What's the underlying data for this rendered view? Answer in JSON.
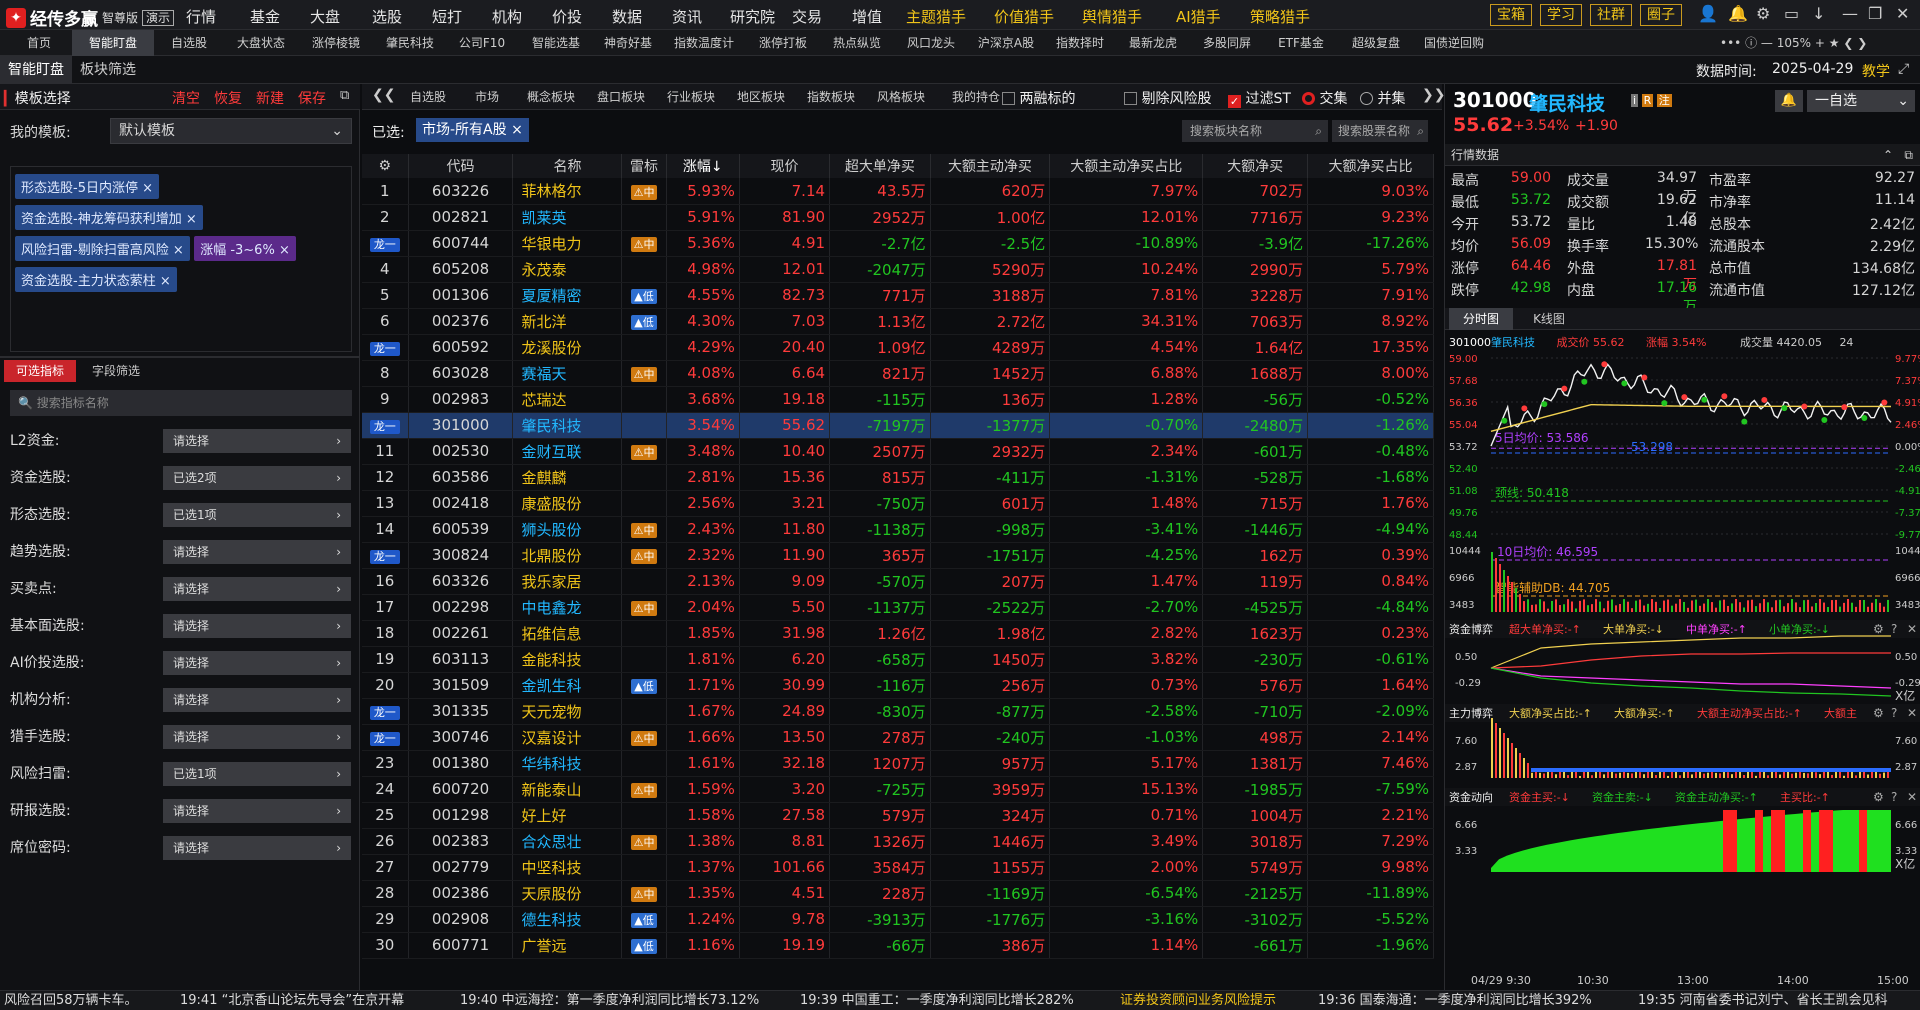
{
  "app": {
    "name": "经传多赢",
    "edition": "智尊版",
    "demo": "演示"
  },
  "menu": [
    "行情",
    "基金",
    "大盘",
    "选股",
    "短打",
    "机构",
    "价投",
    "数据",
    "资讯",
    "研究院",
    "交易",
    "增值"
  ],
  "menu_hunters": [
    "主题猎手",
    "价值猎手",
    "舆情猎手",
    "AI猎手",
    "策略猎手"
  ],
  "top_buttons": [
    "宝箱",
    "学习",
    "社群",
    "圈子"
  ],
  "zoom": "105%",
  "tabs": [
    "首页",
    "智能盯盘",
    "自选股",
    "大盘状态",
    "涨停棱镜",
    "肇民科技",
    "公司F10",
    "智能选基",
    "神奇好基",
    "指数温度计",
    "涨停打板",
    "热点纵览",
    "风口龙头",
    "沪深京A股",
    "指数择时",
    "最新龙虎",
    "多股同屏",
    "ETF基金",
    "超级复盘",
    "国债逆回购"
  ],
  "subhdr": {
    "left_tabs": [
      "智能盯盘",
      "板块筛选"
    ],
    "data_time_label": "数据时间:",
    "data_time": "2025-04-29",
    "teach": "教学"
  },
  "left": {
    "title": "模板选择",
    "actions": [
      "清空",
      "恢复",
      "新建",
      "保存"
    ],
    "my_template_label": "我的模板:",
    "my_template_value": "默认模板",
    "tags": [
      "形态选股-5日内涨停",
      "资金选股-神龙筹码获利增加",
      "风险扫雷-剔除扫雷高风险",
      "涨幅 -3~6%",
      "资金选股-主力状态萦柱"
    ],
    "indicator_tabs": [
      "可选指标",
      "字段筛选"
    ],
    "search_placeholder": "搜索指标名称",
    "rows": [
      {
        "label": "L2资金:",
        "value": "请选择"
      },
      {
        "label": "资金选股:",
        "value": "已选2项"
      },
      {
        "label": "形态选股:",
        "value": "已选1项"
      },
      {
        "label": "趋势选股:",
        "value": "请选择"
      },
      {
        "label": "买卖点:",
        "value": "请选择"
      },
      {
        "label": "基本面选股:",
        "value": "请选择"
      },
      {
        "label": "AI价投选股:",
        "value": "请选择"
      },
      {
        "label": "机构分析:",
        "value": "请选择"
      },
      {
        "label": "猎手选股:",
        "value": "请选择"
      },
      {
        "label": "风险扫雷:",
        "value": "已选1项"
      },
      {
        "label": "研报选股:",
        "value": "请选择"
      },
      {
        "label": "席位密码:",
        "value": "请选择"
      }
    ]
  },
  "mid": {
    "tabs": [
      "自选股",
      "市场",
      "概念板块",
      "盘口板块",
      "行业板块",
      "地区板块",
      "指数板块",
      "风格板块",
      "我的持仓"
    ],
    "options": [
      "两融标的",
      "剔除风险股",
      "过滤ST",
      "交集",
      "并集"
    ],
    "selected_label": "已选:",
    "selected_chip": "市场-所有A股",
    "search_board": "搜索板块名称",
    "search_stock": "搜索股票名称",
    "columns": [
      "代码",
      "名称",
      "雷标",
      "涨幅↓",
      "现价",
      "超大单净买",
      "大额主动净买",
      "大额主动净买占比",
      "大额净买",
      "大额净买占比"
    ],
    "leader_label": "龙一",
    "rows": [
      {
        "n": "1",
        "code": "603226",
        "name": "菲林格尔",
        "lead": false,
        "badge": "中",
        "chg": "5.93%",
        "price": "7.14",
        "a": "43.5万",
        "b": "620万",
        "c": "7.97%",
        "d": "702万",
        "e": "9.03%"
      },
      {
        "n": "2",
        "code": "002821",
        "name": "凯莱英",
        "lead": false,
        "badge": "",
        "chg": "5.91%",
        "price": "81.90",
        "a": "2952万",
        "b": "1.00亿",
        "c": "12.01%",
        "d": "7716万",
        "e": "9.23%"
      },
      {
        "n": "",
        "code": "600744",
        "name": "华银电力",
        "lead": true,
        "badge": "中",
        "chg": "5.36%",
        "price": "4.91",
        "a": "-2.7亿",
        "b": "-2.5亿",
        "c": "-10.89%",
        "d": "-3.9亿",
        "e": "-17.26%"
      },
      {
        "n": "4",
        "code": "605208",
        "name": "永茂泰",
        "lead": false,
        "badge": "",
        "chg": "4.98%",
        "price": "12.01",
        "a": "-2047万",
        "b": "5290万",
        "c": "10.24%",
        "d": "2990万",
        "e": "5.79%"
      },
      {
        "n": "5",
        "code": "001306",
        "name": "夏厦精密",
        "lead": false,
        "badge": "低",
        "chg": "4.55%",
        "price": "82.73",
        "a": "771万",
        "b": "3188万",
        "c": "7.81%",
        "d": "3228万",
        "e": "7.91%"
      },
      {
        "n": "6",
        "code": "002376",
        "name": "新北洋",
        "lead": false,
        "badge": "低",
        "chg": "4.30%",
        "price": "7.03",
        "a": "1.13亿",
        "b": "2.72亿",
        "c": "34.31%",
        "d": "7063万",
        "e": "8.92%"
      },
      {
        "n": "",
        "code": "600592",
        "name": "龙溪股份",
        "lead": true,
        "badge": "",
        "chg": "4.29%",
        "price": "20.40",
        "a": "1.09亿",
        "b": "4289万",
        "c": "4.54%",
        "d": "1.64亿",
        "e": "17.35%"
      },
      {
        "n": "8",
        "code": "603028",
        "name": "赛福天",
        "lead": false,
        "badge": "中",
        "chg": "4.08%",
        "price": "6.64",
        "a": "821万",
        "b": "1452万",
        "c": "6.88%",
        "d": "1688万",
        "e": "8.00%"
      },
      {
        "n": "9",
        "code": "002983",
        "name": "芯瑞达",
        "lead": false,
        "badge": "",
        "chg": "3.68%",
        "price": "19.18",
        "a": "-115万",
        "b": "136万",
        "c": "1.28%",
        "d": "-56万",
        "e": "-0.52%"
      },
      {
        "n": "",
        "code": "301000",
        "name": "肇民科技",
        "lead": true,
        "badge": "",
        "chg": "3.54%",
        "price": "55.62",
        "a": "-7197万",
        "b": "-1377万",
        "c": "-0.70%",
        "d": "-2480万",
        "e": "-1.26%",
        "sel": true
      },
      {
        "n": "11",
        "code": "002530",
        "name": "金财互联",
        "lead": false,
        "badge": "中",
        "chg": "3.48%",
        "price": "10.40",
        "a": "2507万",
        "b": "2932万",
        "c": "2.34%",
        "d": "-601万",
        "e": "-0.48%"
      },
      {
        "n": "12",
        "code": "603586",
        "name": "金麒麟",
        "lead": false,
        "badge": "",
        "chg": "2.81%",
        "price": "15.36",
        "a": "815万",
        "b": "-411万",
        "c": "-1.31%",
        "d": "-528万",
        "e": "-1.68%"
      },
      {
        "n": "13",
        "code": "002418",
        "name": "康盛股份",
        "lead": false,
        "badge": "",
        "chg": "2.56%",
        "price": "3.21",
        "a": "-750万",
        "b": "601万",
        "c": "1.48%",
        "d": "715万",
        "e": "1.76%"
      },
      {
        "n": "14",
        "code": "600539",
        "name": "狮头股份",
        "lead": false,
        "badge": "中",
        "chg": "2.43%",
        "price": "11.80",
        "a": "-1138万",
        "b": "-998万",
        "c": "-3.41%",
        "d": "-1446万",
        "e": "-4.94%"
      },
      {
        "n": "",
        "code": "300824",
        "name": "北鼎股份",
        "lead": true,
        "badge": "中",
        "chg": "2.32%",
        "price": "11.90",
        "a": "365万",
        "b": "-1751万",
        "c": "-4.25%",
        "d": "162万",
        "e": "0.39%"
      },
      {
        "n": "16",
        "code": "603326",
        "name": "我乐家居",
        "lead": false,
        "badge": "",
        "chg": "2.13%",
        "price": "9.09",
        "a": "-570万",
        "b": "207万",
        "c": "1.47%",
        "d": "119万",
        "e": "0.84%"
      },
      {
        "n": "17",
        "code": "002298",
        "name": "中电鑫龙",
        "lead": false,
        "badge": "中",
        "chg": "2.04%",
        "price": "5.50",
        "a": "-1137万",
        "b": "-2522万",
        "c": "-2.70%",
        "d": "-4525万",
        "e": "-4.84%"
      },
      {
        "n": "18",
        "code": "002261",
        "name": "拓维信息",
        "lead": false,
        "badge": "",
        "chg": "1.85%",
        "price": "31.98",
        "a": "1.26亿",
        "b": "1.98亿",
        "c": "2.82%",
        "d": "1623万",
        "e": "0.23%"
      },
      {
        "n": "19",
        "code": "603113",
        "name": "金能科技",
        "lead": false,
        "badge": "",
        "chg": "1.81%",
        "price": "6.20",
        "a": "-658万",
        "b": "1450万",
        "c": "3.82%",
        "d": "-230万",
        "e": "-0.61%"
      },
      {
        "n": "20",
        "code": "301509",
        "name": "金凯生科",
        "lead": false,
        "badge": "低",
        "chg": "1.71%",
        "price": "30.99",
        "a": "-116万",
        "b": "256万",
        "c": "0.73%",
        "d": "576万",
        "e": "1.64%"
      },
      {
        "n": "",
        "code": "301335",
        "name": "天元宠物",
        "lead": true,
        "badge": "",
        "chg": "1.67%",
        "price": "24.89",
        "a": "-830万",
        "b": "-877万",
        "c": "-2.58%",
        "d": "-710万",
        "e": "-2.09%"
      },
      {
        "n": "",
        "code": "300746",
        "name": "汉嘉设计",
        "lead": true,
        "badge": "中",
        "chg": "1.66%",
        "price": "13.50",
        "a": "278万",
        "b": "-240万",
        "c": "-1.03%",
        "d": "498万",
        "e": "2.14%"
      },
      {
        "n": "23",
        "code": "001380",
        "name": "华纬科技",
        "lead": false,
        "badge": "",
        "chg": "1.61%",
        "price": "32.18",
        "a": "1207万",
        "b": "957万",
        "c": "5.17%",
        "d": "1381万",
        "e": "7.46%"
      },
      {
        "n": "24",
        "code": "600720",
        "name": "新能泰山",
        "lead": false,
        "badge": "中",
        "chg": "1.59%",
        "price": "3.20",
        "a": "-725万",
        "b": "3959万",
        "c": "15.13%",
        "d": "-1985万",
        "e": "-7.59%"
      },
      {
        "n": "25",
        "code": "001298",
        "name": "好上好",
        "lead": false,
        "badge": "",
        "chg": "1.58%",
        "price": "27.58",
        "a": "579万",
        "b": "324万",
        "c": "0.71%",
        "d": "1004万",
        "e": "2.21%"
      },
      {
        "n": "26",
        "code": "002383",
        "name": "合众思壮",
        "lead": false,
        "badge": "中",
        "chg": "1.38%",
        "price": "8.81",
        "a": "1326万",
        "b": "1446万",
        "c": "3.49%",
        "d": "3018万",
        "e": "7.29%"
      },
      {
        "n": "27",
        "code": "002779",
        "name": "中坚科技",
        "lead": false,
        "badge": "",
        "chg": "1.37%",
        "price": "101.66",
        "a": "3584万",
        "b": "1155万",
        "c": "2.00%",
        "d": "5749万",
        "e": "9.98%"
      },
      {
        "n": "28",
        "code": "002386",
        "name": "天原股份",
        "lead": false,
        "badge": "中",
        "chg": "1.35%",
        "price": "4.51",
        "a": "228万",
        "b": "-1169万",
        "c": "-6.54%",
        "d": "-2125万",
        "e": "-11.89%"
      },
      {
        "n": "29",
        "code": "002908",
        "name": "德生科技",
        "lead": false,
        "badge": "低",
        "chg": "1.24%",
        "price": "9.78",
        "a": "-3913万",
        "b": "-1776万",
        "c": "-3.16%",
        "d": "-3102万",
        "e": "-5.52%"
      },
      {
        "n": "30",
        "code": "600771",
        "name": "广誉远",
        "lead": false,
        "badge": "低",
        "chg": "1.16%",
        "price": "19.19",
        "a": "-66万",
        "b": "386万",
        "c": "1.14%",
        "d": "-661万",
        "e": "-1.96%"
      }
    ]
  },
  "right": {
    "code": "301000",
    "name": "肇民科技",
    "price": "55.62",
    "chg_pct": "+3.54%",
    "chg": "+1.90",
    "watch": "一自选",
    "quote_title": "行情数据",
    "quote": [
      [
        "最高",
        "59.00",
        "成交量",
        "34.97万",
        "市盈率",
        "92.27"
      ],
      [
        "最低",
        "53.72",
        "成交额",
        "19.62亿",
        "市净率",
        "11.14"
      ],
      [
        "今开",
        "53.72",
        "量比",
        "1.48",
        "总股本",
        "2.42亿"
      ],
      [
        "均价",
        "56.09",
        "换手率",
        "15.30%",
        "流通股本",
        "2.29亿"
      ],
      [
        "涨停",
        "64.46",
        "外盘",
        "17.81万",
        "总市值",
        "134.68亿"
      ],
      [
        "跌停",
        "42.98",
        "内盘",
        "17.16万",
        "流通市值",
        "127.12亿"
      ]
    ],
    "chart_tabs": [
      "分时图",
      "K线图"
    ],
    "chart_hdr": {
      "code": "301000",
      "name": "肇民科技",
      "price_label": "成交价 55.62",
      "pct_label": "涨幅 3.54%",
      "vol_label": "成交量 4420.05",
      "right": "24"
    },
    "price_axis_left": [
      "59.00",
      "57.68",
      "56.36",
      "55.04",
      "53.72",
      "52.40",
      "51.08",
      "49.76",
      "48.44"
    ],
    "price_axis_right": [
      "9.77%",
      "7.37%",
      "4.91%",
      "2.46%",
      "0.00%",
      "-2.46%",
      "-4.91%",
      "-7.37%",
      "-9.77%"
    ],
    "ma_labels": {
      "ma5": "5日均价: 53.586",
      "ma5b": "53.298",
      "neck": "颈线: 50.418",
      "ma10": "10日均价: 46.595"
    },
    "vol_axis": [
      "10444",
      "6966",
      "3483"
    ],
    "vol_label": "智能辅助DB: 44.705",
    "p1": {
      "title": "资金博弈",
      "items": [
        "超大单净买:-↑",
        "大单净买:-↓",
        "中单净买:-↑",
        "小单净买:-↓"
      ],
      "axis": [
        "0.50",
        "-0.29"
      ],
      "unit": "X亿"
    },
    "p2": {
      "title": "主力博弈",
      "items": [
        "大额净买占比:-↑",
        "大额净买:-↑",
        "大额主动净买占比:-↑",
        "大额主"
      ],
      "axis": [
        "7.60",
        "2.87"
      ]
    },
    "p3": {
      "title": "资金动向",
      "items": [
        "资金主买:-↓",
        "资金主卖:-↓",
        "资金主动净买:-↑",
        "主买比:-↑"
      ],
      "axis": [
        "6.66",
        "3.33"
      ],
      "unit": "X亿"
    },
    "time_axis": [
      "04/29 9:30",
      "10:30",
      "13:00",
      "14:00",
      "15:00"
    ]
  },
  "ticker": [
    "风险召回58万辆卡车。",
    "19:41 “北京香山论坛先导会”在京开幕",
    "19:40 中远海控：第一季度净利润同比增长73.12%",
    "19:39 中国重工：一季度净利润同比增长282%",
    "证券投资顾问业务风险提示",
    "19:36 国泰海通：一季度净利润同比增长392%",
    "19:35 河南省委书记刘宁、省长王凯会见科"
  ],
  "chart_data": {
    "type": "line",
    "title": "",
    "x": [
      "9:30",
      "10:30",
      "13:00",
      "14:00",
      "15:00"
    ],
    "series": [
      {
        "name": "成交价",
        "values": [
          53.72,
          58.4,
          56.4,
          55.9,
          55.62
        ]
      },
      {
        "name": "均价",
        "values": [
          54.6,
          56.2,
          56.1,
          56.1,
          56.09
        ]
      }
    ],
    "ylim": [
      48.44,
      59.0
    ]
  }
}
